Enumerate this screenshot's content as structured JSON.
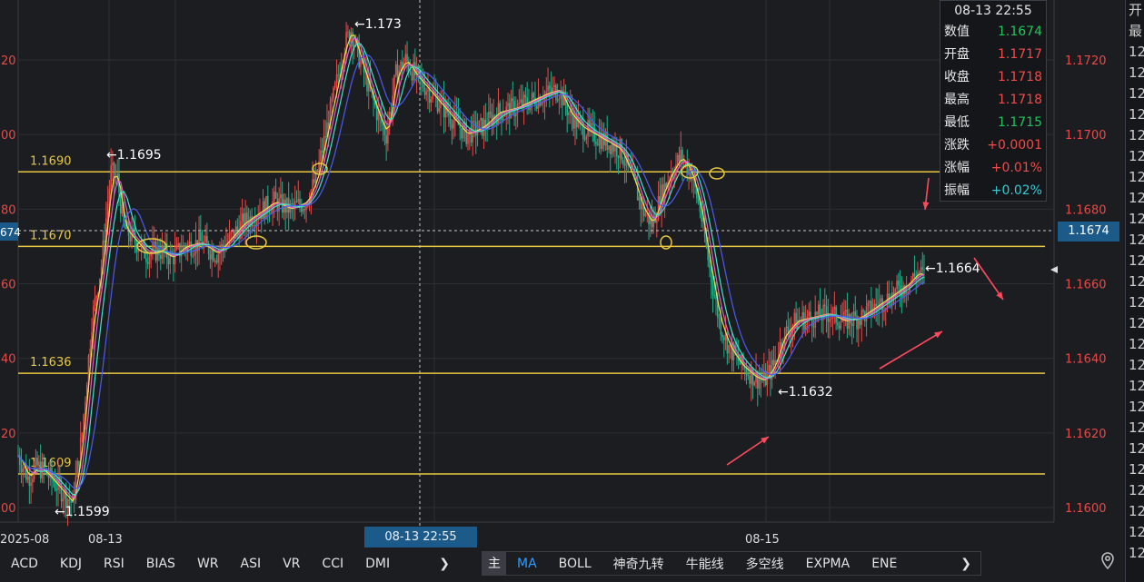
{
  "axis": {
    "left_ticks": [
      "20",
      "00",
      "80",
      "60",
      "40",
      "20",
      "00"
    ],
    "right_ticks": [
      "1.1720",
      "1.1700",
      "1.1680",
      "1.1660",
      "1.1640",
      "1.1620",
      "1.1600"
    ],
    "x_ticks": [
      "2025-08",
      "08-13",
      "08-15"
    ],
    "left_cut_price": "674"
  },
  "levels": [
    {
      "label": "1.1690",
      "y": 1.169
    },
    {
      "label": "1.1670",
      "y": 1.167
    },
    {
      "label": "1.1636",
      "y": 1.1636
    },
    {
      "label": "1.1609",
      "y": 1.1609
    }
  ],
  "annotations": {
    "high_1695": "←1.1695",
    "high_173": "←1.173",
    "low_1599": "←1.1599",
    "low_1632": "←1.1632",
    "last_1664": "←1.1664"
  },
  "crosshair": {
    "time_label": "08-13 22:55",
    "price_label": "1.1674"
  },
  "info_panel": {
    "title": "08-13 22:55",
    "rows": [
      {
        "k": "数值",
        "v": "1.1674",
        "c": "green"
      },
      {
        "k": "开盘",
        "v": "1.1717",
        "c": "red"
      },
      {
        "k": "收盘",
        "v": "1.1718",
        "c": "red"
      },
      {
        "k": "最高",
        "v": "1.1718",
        "c": "red"
      },
      {
        "k": "最低",
        "v": "1.1715",
        "c": "green"
      },
      {
        "k": "涨跌",
        "v": "+0.0001",
        "c": "red"
      },
      {
        "k": "涨幅",
        "v": "+0.01%",
        "c": "red"
      },
      {
        "k": "振幅",
        "v": "+0.02%",
        "c": "cyan"
      }
    ]
  },
  "right_strip": [
    "开",
    "最",
    "12",
    "12",
    "12",
    "12",
    "12",
    "12",
    "12",
    "12",
    "12",
    "12",
    "12",
    "12",
    "12",
    "12",
    "12",
    "12",
    "12",
    "12",
    "12",
    "12",
    "12",
    "12",
    "12",
    "12",
    "12"
  ],
  "tabs_left": [
    "ACD",
    "KDJ",
    "RSI",
    "BIAS",
    "WR",
    "ASI",
    "VR",
    "CCI",
    "DMI"
  ],
  "tabs_right": {
    "main": "主",
    "items": [
      "MA",
      "BOLL",
      "神奇九转",
      "牛能线",
      "多空线",
      "EXPMA",
      "ENE"
    ]
  },
  "chevron": "❯",
  "colors": {
    "bg": "#1c1d21",
    "level": "#e8c840",
    "up": "#e84a4a",
    "down": "#1fb28a",
    "annot_arrow": "#ff4a5e"
  },
  "price_path": [
    [
      0,
      1.1614
    ],
    [
      6,
      1.1608
    ],
    [
      12,
      1.1611
    ],
    [
      18,
      1.1609
    ],
    [
      26,
      1.1605
    ],
    [
      34,
      1.1601
    ],
    [
      40,
      1.162
    ],
    [
      46,
      1.165
    ],
    [
      52,
      1.1665
    ],
    [
      58,
      1.169
    ],
    [
      62,
      1.1688
    ],
    [
      66,
      1.1675
    ],
    [
      72,
      1.1672
    ],
    [
      80,
      1.1668
    ],
    [
      88,
      1.1669
    ],
    [
      96,
      1.1667
    ],
    [
      104,
      1.167
    ],
    [
      114,
      1.1671
    ],
    [
      124,
      1.1668
    ],
    [
      132,
      1.1672
    ],
    [
      140,
      1.1676
    ],
    [
      150,
      1.1679
    ],
    [
      160,
      1.1682
    ],
    [
      170,
      1.168
    ],
    [
      180,
      1.1682
    ],
    [
      186,
      1.1688
    ],
    [
      192,
      1.17
    ],
    [
      198,
      1.1712
    ],
    [
      204,
      1.1724
    ],
    [
      208,
      1.1728
    ],
    [
      212,
      1.1722
    ],
    [
      218,
      1.1714
    ],
    [
      224,
      1.1706
    ],
    [
      230,
      1.17
    ],
    [
      236,
      1.1716
    ],
    [
      242,
      1.172
    ],
    [
      248,
      1.1716
    ],
    [
      256,
      1.1712
    ],
    [
      264,
      1.1708
    ],
    [
      272,
      1.1704
    ],
    [
      280,
      1.17
    ],
    [
      290,
      1.1702
    ],
    [
      300,
      1.1706
    ],
    [
      310,
      1.1707
    ],
    [
      320,
      1.1709
    ],
    [
      330,
      1.1711
    ],
    [
      338,
      1.1712
    ],
    [
      344,
      1.1706
    ],
    [
      352,
      1.1702
    ],
    [
      360,
      1.17
    ],
    [
      368,
      1.1698
    ],
    [
      376,
      1.1696
    ],
    [
      384,
      1.1688
    ],
    [
      390,
      1.168
    ],
    [
      396,
      1.1676
    ],
    [
      402,
      1.1684
    ],
    [
      408,
      1.169
    ],
    [
      414,
      1.1694
    ],
    [
      420,
      1.169
    ],
    [
      426,
      1.168
    ],
    [
      432,
      1.1664
    ],
    [
      438,
      1.165
    ],
    [
      444,
      1.1643
    ],
    [
      452,
      1.1638
    ],
    [
      460,
      1.1635
    ],
    [
      466,
      1.1634
    ],
    [
      472,
      1.1638
    ],
    [
      478,
      1.1646
    ],
    [
      486,
      1.165
    ],
    [
      496,
      1.1651
    ],
    [
      506,
      1.1652
    ],
    [
      516,
      1.165
    ],
    [
      526,
      1.1651
    ],
    [
      536,
      1.1654
    ],
    [
      546,
      1.1657
    ],
    [
      556,
      1.166
    ],
    [
      562,
      1.1663
    ],
    [
      566,
      1.1662
    ]
  ]
}
